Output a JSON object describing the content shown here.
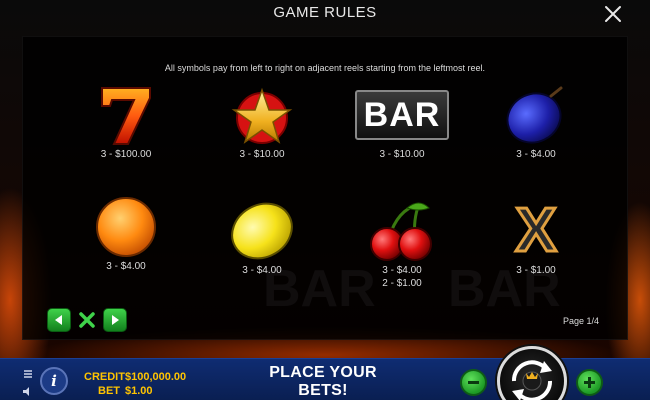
{
  "header": {
    "title": "GAME RULES",
    "close_icon": "close-icon"
  },
  "rules": {
    "description": "All symbols pay from left to right on adjacent reels starting from the leftmost reel."
  },
  "symbols": [
    {
      "name": "seven",
      "pays": [
        "3 - $100.00"
      ]
    },
    {
      "name": "star",
      "pays": [
        "3 - $10.00"
      ]
    },
    {
      "name": "bar",
      "label": "BAR",
      "pays": [
        "3 - $10.00"
      ]
    },
    {
      "name": "plum",
      "pays": [
        "3 - $4.00"
      ]
    },
    {
      "name": "orange",
      "pays": [
        "3 - $4.00"
      ]
    },
    {
      "name": "lemon",
      "pays": [
        "3 - $4.00"
      ]
    },
    {
      "name": "cherries",
      "pays": [
        "3 - $4.00",
        "2 - $1.00"
      ]
    },
    {
      "name": "x",
      "label": "X",
      "pays": [
        "3 - $1.00"
      ]
    }
  ],
  "pagination": {
    "page_label": "Page 1/4",
    "prev_icon": "arrow-left-icon",
    "close_icon": "close-x-icon",
    "next_icon": "arrow-right-icon"
  },
  "bottom_bar": {
    "credit_label": "CREDIT",
    "credit_value": "$100,000.00",
    "bet_label": "BET",
    "bet_value": "$1.00",
    "message": "PLACE YOUR BETS!",
    "info_label": "i",
    "minus_icon": "minus-icon",
    "plus_icon": "plus-icon",
    "spin_icon": "spin-icon",
    "menu_icon": "menu-icon",
    "sound_icon": "sound-icon"
  },
  "colors": {
    "accent_yellow": "#ffc400",
    "bar_blue": "#0f2c72",
    "green_button": "#1d9a25"
  }
}
